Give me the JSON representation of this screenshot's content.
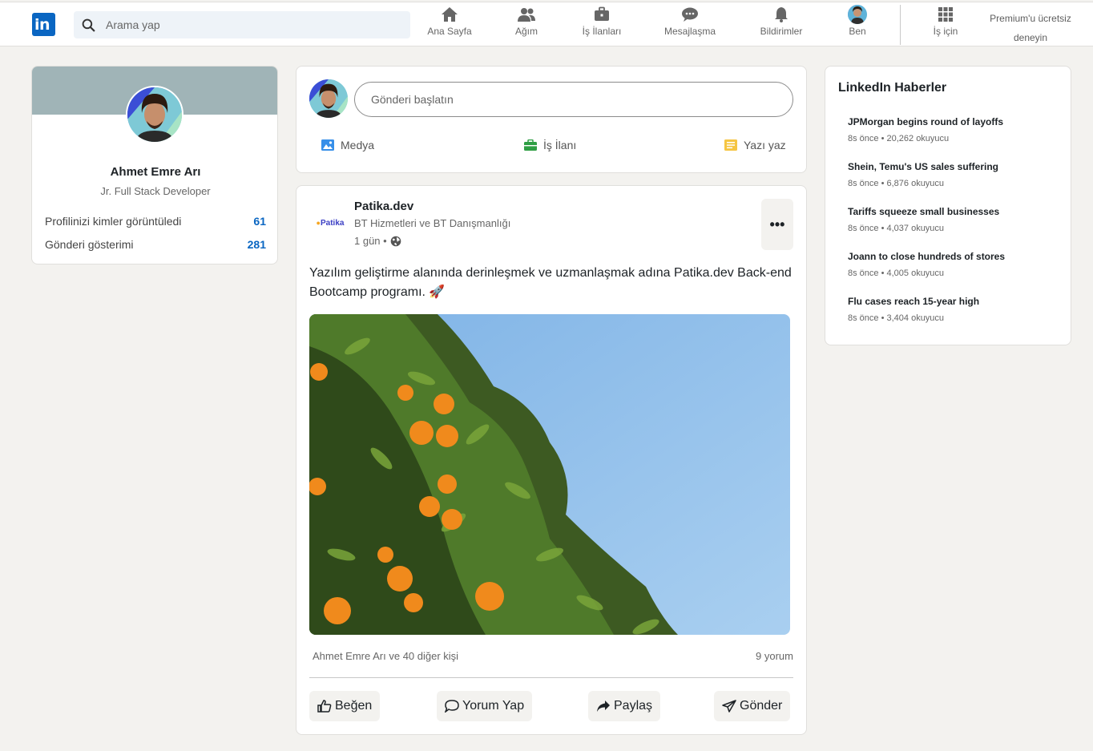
{
  "topbar": {
    "logo_text": "in",
    "search_placeholder": "Arama yap",
    "nav": [
      {
        "label": "Ana Sayfa",
        "icon": "home-icon"
      },
      {
        "label": "Ağım",
        "icon": "network-icon"
      },
      {
        "label": "İş İlanları",
        "icon": "briefcase-icon"
      },
      {
        "label": "Mesajlaşma",
        "icon": "messaging-icon"
      },
      {
        "label": "Bildirimler",
        "icon": "bell-icon"
      },
      {
        "label": "Ben",
        "icon": "avatar"
      },
      {
        "label": "İş için",
        "icon": "grid-icon"
      }
    ],
    "premium_line1": "Premium'u ücretsiz",
    "premium_line2": "deneyin"
  },
  "profile": {
    "name": "Ahmet Emre Arı",
    "title": "Jr. Full Stack Developer",
    "stats": [
      {
        "label": "Profilinizi kimler görüntüledi",
        "value": "61"
      },
      {
        "label": "Gönderi gösterimi",
        "value": "281"
      }
    ]
  },
  "composer": {
    "placeholder": "Gönderi başlatın",
    "actions": [
      {
        "label": "Medya",
        "icon": "image-icon",
        "color": "#378fe9"
      },
      {
        "label": "İş İlanı",
        "icon": "briefcase-icon",
        "color": "#2f9e44"
      },
      {
        "label": "Yazı yaz",
        "icon": "article-icon",
        "color": "#f5c542"
      }
    ]
  },
  "post": {
    "logo_text": "Patika",
    "author": "Patika.dev",
    "subtitle": "BT Hizmetleri ve BT Danışmanlığı",
    "time": "1 gün •",
    "text": "Yazılım geliştirme alanında derinleşmek ve uzmanlaşmak adına Patika.dev Back-end Bootcamp programı. 🚀",
    "reactions": "Ahmet Emre Arı ve 40 diğer kişi",
    "comments": "9 yorum",
    "buttons": [
      {
        "label": "Beğen",
        "icon": "thumbs-up-icon"
      },
      {
        "label": "Yorum Yap",
        "icon": "comment-icon"
      },
      {
        "label": "Paylaş",
        "icon": "share-icon"
      },
      {
        "label": "Gönder",
        "icon": "send-icon"
      }
    ]
  },
  "news": {
    "title": "LinkedIn Haberler",
    "items": [
      {
        "headline": "JPMorgan begins round of layoffs",
        "meta": "8s önce • 20,262 okuyucu"
      },
      {
        "headline": "Shein, Temu's US sales suffering",
        "meta": "8s önce • 6,876 okuyucu"
      },
      {
        "headline": "Tariffs squeeze small businesses",
        "meta": "8s önce • 4,037 okuyucu"
      },
      {
        "headline": "Joann to close hundreds of stores",
        "meta": "8s önce • 4,005 okuyucu"
      },
      {
        "headline": "Flu cases reach 15-year high",
        "meta": "8s önce • 3,404 okuyucu"
      }
    ]
  },
  "colors": {
    "brand": "#0a66c2",
    "background": "#f3f2ef",
    "cover": "#a0b4b7"
  }
}
